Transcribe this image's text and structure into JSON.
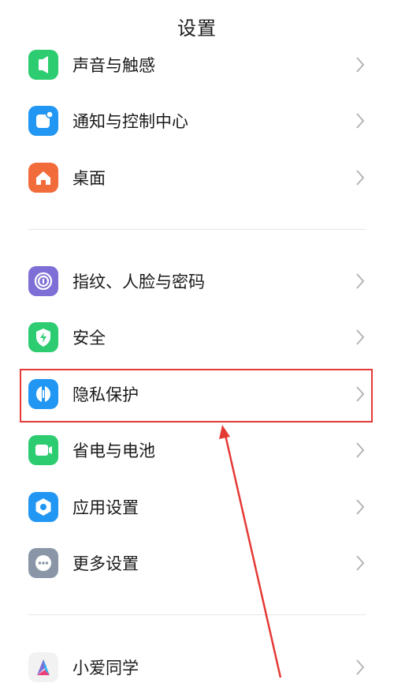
{
  "header": {
    "title": "设置"
  },
  "items": [
    {
      "label": "声音与触感",
      "icon": "speaker-icon",
      "color": "#2ecc71"
    },
    {
      "label": "通知与控制中心",
      "icon": "notification-icon",
      "color": "#2196f3"
    },
    {
      "label": "桌面",
      "icon": "home-icon",
      "color": "#f26b3a"
    },
    {
      "label": "指纹、人脸与密码",
      "icon": "fingerprint-icon",
      "color": "#7e6fd6"
    },
    {
      "label": "安全",
      "icon": "shield-bolt-icon",
      "color": "#2ecc71"
    },
    {
      "label": "隐私保护",
      "icon": "privacy-icon",
      "color": "#2196f3"
    },
    {
      "label": "省电与电池",
      "icon": "battery-icon",
      "color": "#2ecc71"
    },
    {
      "label": "应用设置",
      "icon": "gear-icon",
      "color": "#2196f3"
    },
    {
      "label": "更多设置",
      "icon": "more-dots-icon",
      "color": "#8a96a8"
    },
    {
      "label": "小爱同学",
      "icon": "xiaoai-icon",
      "color": "#f2f2f2"
    }
  ],
  "annotation": {
    "highlight_color": "#e53935"
  }
}
